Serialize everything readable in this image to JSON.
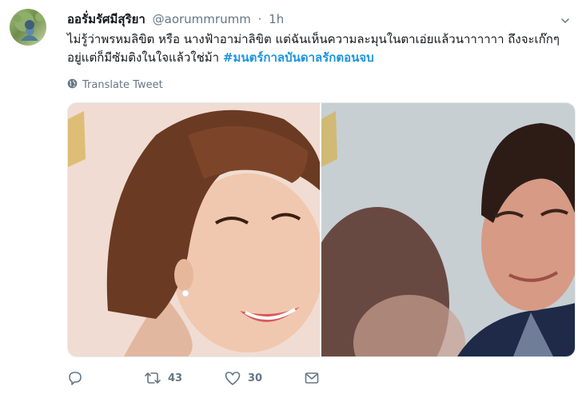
{
  "tweet": {
    "display_name": "ออรั่มรัศมีสุริยา",
    "handle": "@aorummrumm",
    "separator": "·",
    "time": "1h",
    "text": "ไม่รู้ว่าพรหมลิขิต หรือ นางฟ้าอาม่าลิขิต แต่ฉันเห็นความละมุนในตาเอ่ยแล้วนาาาาาา ถึงจะเก๊กๆ อยู่แต่ก็มีซัมติงในใจแล้วใช่ม้า ",
    "hashtag": "#มนตร์กาลบันดาลรักตอนจบ",
    "translate_label": "Translate Tweet",
    "media": {
      "left_photo": "woman-smiling-photo",
      "right_photo": "man-smiling-photo"
    },
    "actions": {
      "reply_icon": "reply-icon",
      "retweet_icon": "retweet-icon",
      "retweet_count": "43",
      "like_icon": "heart-icon",
      "like_count": "30",
      "dm_icon": "envelope-icon"
    },
    "colors": {
      "hashtag": "#1b95e0",
      "muted": "#657786",
      "text": "#14171a"
    }
  }
}
